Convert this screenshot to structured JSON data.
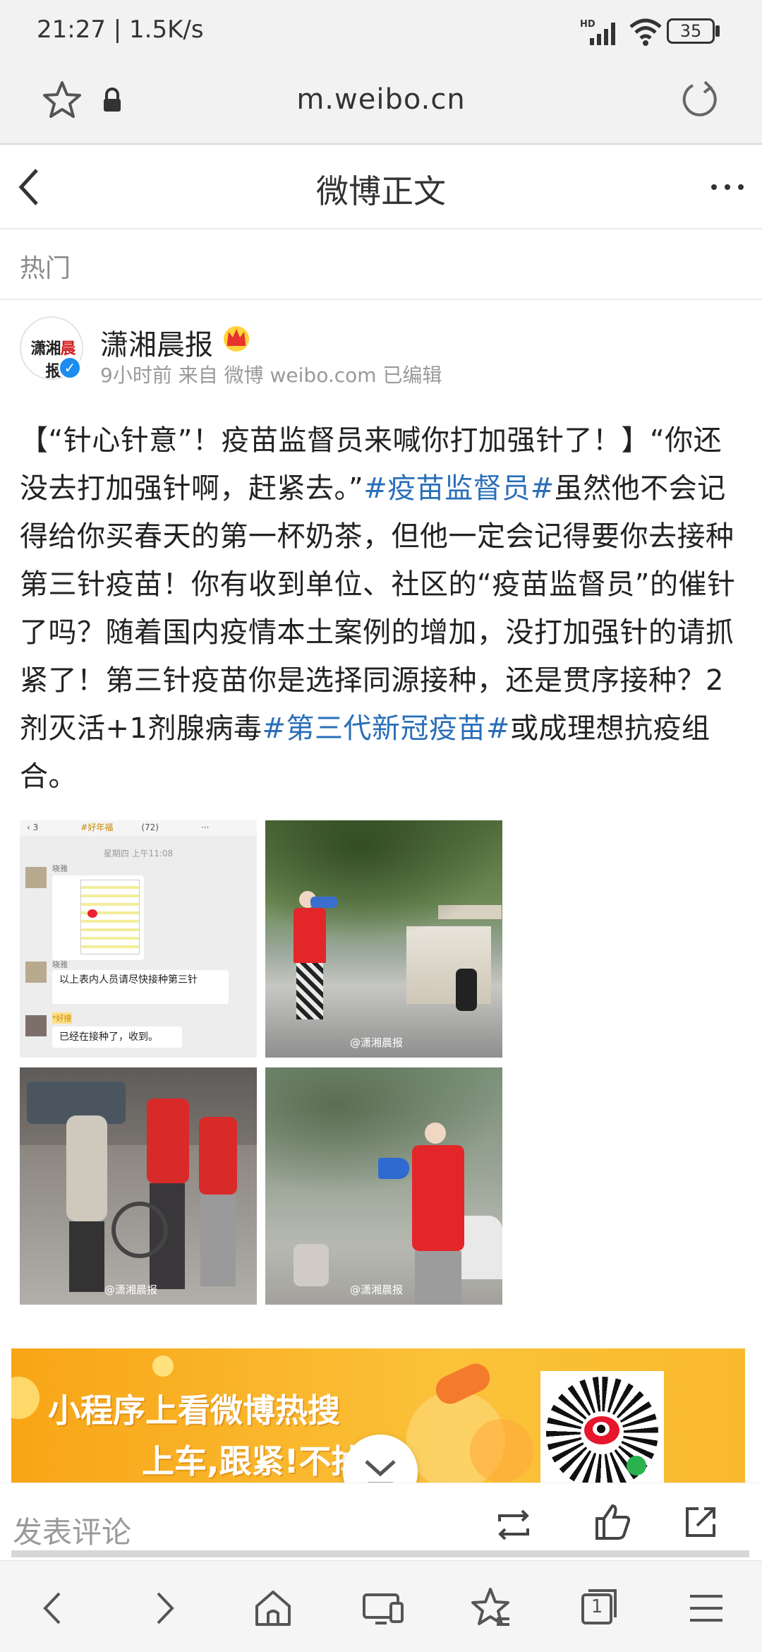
{
  "status_bar": {
    "time_speed": "21:27 | 1.5K/s",
    "network_label": "HD",
    "battery": "35"
  },
  "address_bar": {
    "url": "m.weibo.cn"
  },
  "nav": {
    "title": "微博正文"
  },
  "section_label": "热门",
  "author": {
    "name": "潇湘晨报",
    "avatar_text_a": "潇湘",
    "avatar_text_b": "晨",
    "avatar_text_c": "报",
    "meta": "9小时前 来自 微博 weibo.com 已编辑"
  },
  "post": {
    "text_1": "【“针心针意”！疫苗监督员来喊你打加强针了！】“你还没去打加强针啊，赶紧去。”",
    "tag_1": "#疫苗监督员#",
    "text_2": "虽然他不会记得给你买春天的第一杯奶茶，但他一定会记得要你去接种第三针疫苗！你有收到单位、社区的“疫苗监督员”的催针了吗？随着国内疫情本土案例的增加，没打加强针的请抓紧了！第三针疫苗你是选择同源接种，还是贯序接种？2剂灭活+1剂腺病毒",
    "tag_2": "#第三代新冠疫苗#",
    "text_3": "或成理想抗疫组合。"
  },
  "images": {
    "chat": {
      "header_count": "3",
      "header_chip_1": "#好年福",
      "header_count_2": "(72)",
      "date": "星期四 上午11:08",
      "sender_1": "晓雅",
      "sender_2": "晓雅",
      "message_1": "以上表内人员请尽快接种第三针",
      "sender_3": "*好接",
      "message_2": "已经在接种了，收到。"
    },
    "watermark": "@潇湘晨报"
  },
  "banner": {
    "line1": "小程序上看微博热搜",
    "line2": "上车,跟紧!不掉"
  },
  "action_bar": {
    "comment_placeholder": "发表评论"
  },
  "browser_bar": {
    "tabs_count": "1"
  },
  "colors": {
    "link": "#2a6fb8",
    "banner": "#f9b024",
    "verified": "#1c8cf0"
  }
}
